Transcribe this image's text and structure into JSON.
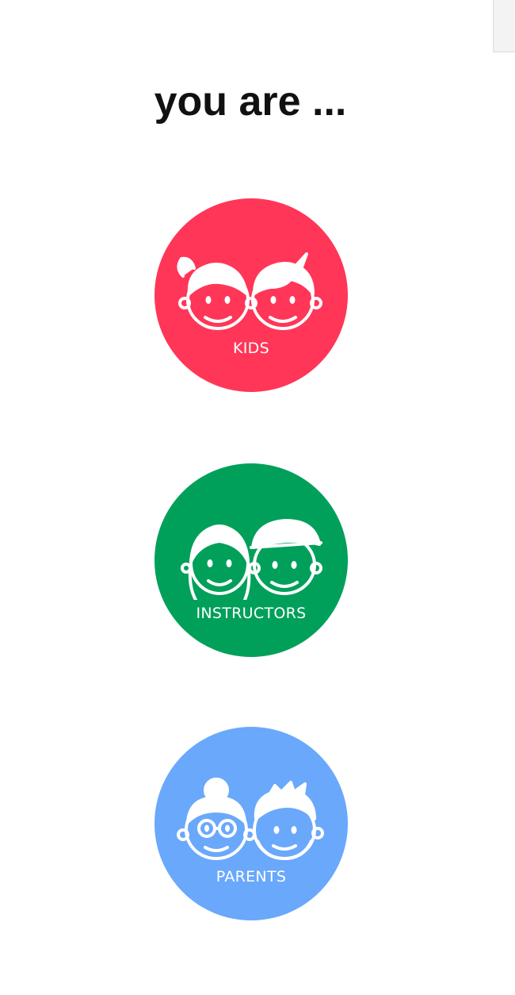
{
  "heading": "you are ...",
  "colors": {
    "kids": "#ff3658",
    "instructors": "#00a05a",
    "parents": "#6aa8fb"
  },
  "roles": [
    {
      "id": "kids",
      "label": "KIDS",
      "icon": "kids-faces-icon"
    },
    {
      "id": "instructors",
      "label": "INSTRUCTORS",
      "icon": "instructors-faces-icon"
    },
    {
      "id": "parents",
      "label": "PARENTS",
      "icon": "parents-faces-icon"
    }
  ]
}
